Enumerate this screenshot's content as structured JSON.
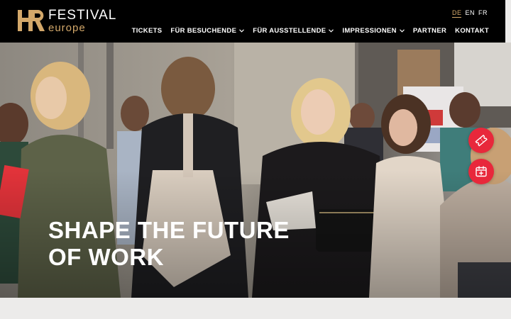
{
  "logo": {
    "line1": "FESTIVAL",
    "line2": "europe"
  },
  "languages": [
    {
      "code": "DE",
      "active": true
    },
    {
      "code": "EN",
      "active": false
    },
    {
      "code": "FR",
      "active": false
    }
  ],
  "nav": [
    {
      "label": "TICKETS",
      "has_dropdown": false
    },
    {
      "label": "FÜR BESUCHENDE",
      "has_dropdown": true
    },
    {
      "label": "FÜR AUSSTELLENDE",
      "has_dropdown": true
    },
    {
      "label": "IMPRESSIONEN",
      "has_dropdown": true
    },
    {
      "label": "PARTNER",
      "has_dropdown": false
    },
    {
      "label": "KONTAKT",
      "has_dropdown": false
    }
  ],
  "hero": {
    "title_line1": "SHAPE THE FUTURE",
    "title_line2": "OF WORK"
  },
  "floating_buttons": [
    {
      "icon": "ticket-icon"
    },
    {
      "icon": "calendar-plus-icon"
    }
  ],
  "colors": {
    "header_bg": "#000000",
    "accent_gold": "#d3a86a",
    "cta_red": "#e8283b",
    "page_bg": "#ecebea"
  }
}
